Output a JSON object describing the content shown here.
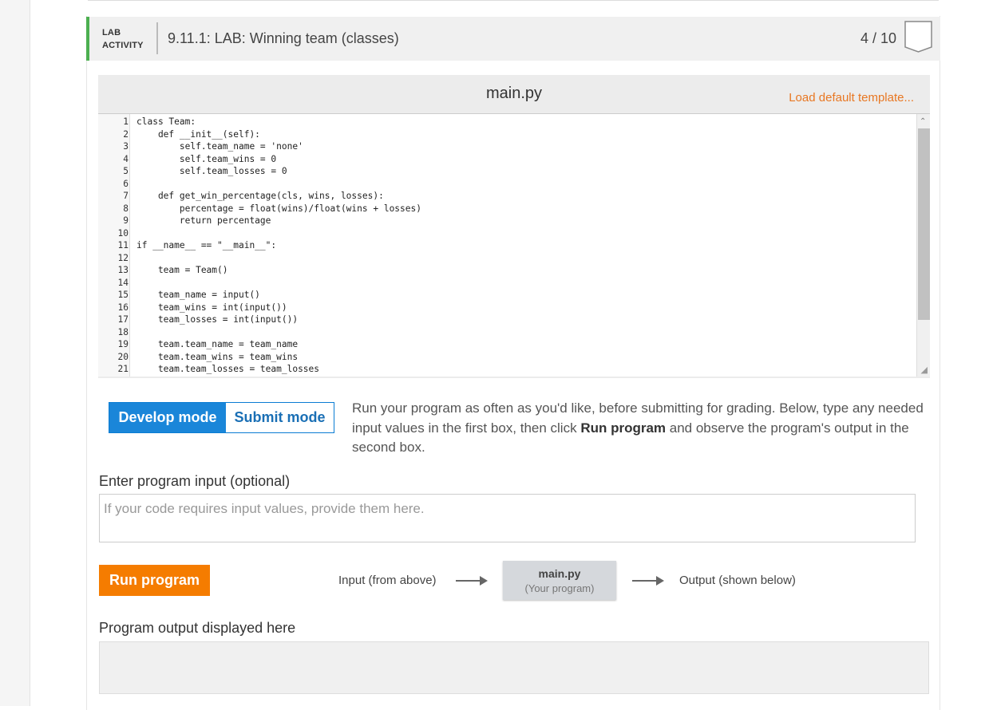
{
  "header": {
    "activity_label_line1": "LAB",
    "activity_label_line2": "ACTIVITY",
    "title": "9.11.1: LAB: Winning team (classes)",
    "score": "4 / 10",
    "accent_color": "#4caf50"
  },
  "editor": {
    "file_name": "main.py",
    "load_template": "Load default template...",
    "lines": [
      {
        "n": "1",
        "code": "class Team:"
      },
      {
        "n": "2",
        "code": "    def __init__(self):"
      },
      {
        "n": "3",
        "code": "        self.team_name = 'none'"
      },
      {
        "n": "4",
        "code": "        self.team_wins = 0"
      },
      {
        "n": "5",
        "code": "        self.team_losses = 0"
      },
      {
        "n": "6",
        "code": ""
      },
      {
        "n": "7",
        "code": "    def get_win_percentage(cls, wins, losses):"
      },
      {
        "n": "8",
        "code": "        percentage = float(wins)/float(wins + losses)"
      },
      {
        "n": "9",
        "code": "        return percentage"
      },
      {
        "n": "10",
        "code": ""
      },
      {
        "n": "11",
        "code": "if __name__ == \"__main__\":"
      },
      {
        "n": "12",
        "code": ""
      },
      {
        "n": "13",
        "code": "    team = Team()"
      },
      {
        "n": "14",
        "code": ""
      },
      {
        "n": "15",
        "code": "    team_name = input()"
      },
      {
        "n": "16",
        "code": "    team_wins = int(input())"
      },
      {
        "n": "17",
        "code": "    team_losses = int(input())"
      },
      {
        "n": "18",
        "code": ""
      },
      {
        "n": "19",
        "code": "    team.team_name = team_name"
      },
      {
        "n": "20",
        "code": "    team.team_wins = team_wins"
      },
      {
        "n": "21",
        "code": "    team.team_losses = team_losses"
      }
    ]
  },
  "modes": {
    "develop": "Develop mode",
    "submit": "Submit mode",
    "active": "develop"
  },
  "instructions": {
    "part1": "Run your program as often as you'd like, before submitting for grading. Below, type any needed input values in the first box, then click ",
    "bold": "Run program",
    "part2": " and observe the program's output in the second box."
  },
  "input": {
    "label": "Enter program input (optional)",
    "placeholder": "If your code requires input values, provide them here.",
    "value": ""
  },
  "run": {
    "button": "Run program",
    "flow_input": "Input (from above)",
    "program_name": "main.py",
    "program_sub": "(Your program)",
    "flow_output": "Output (shown below)",
    "button_color": "#f57c00"
  },
  "output": {
    "label": "Program output displayed here",
    "value": ""
  }
}
